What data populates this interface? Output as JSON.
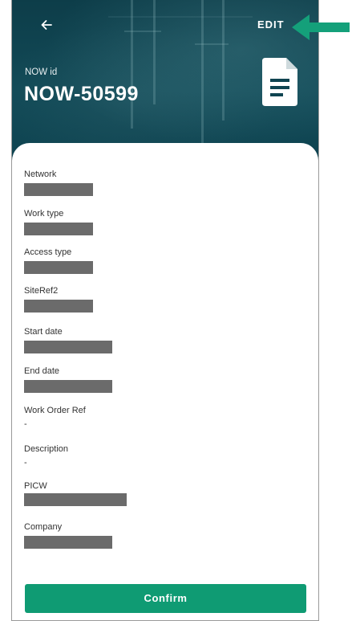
{
  "header": {
    "edit_label": "EDIT",
    "id_label": "NOW id",
    "id_value": "NOW-50599"
  },
  "fields": [
    {
      "label": "Network",
      "value": null
    },
    {
      "label": "Work type",
      "value": null
    },
    {
      "label": "Access type",
      "value": null
    },
    {
      "label": "SiteRef2",
      "value": null
    },
    {
      "label": "Start date",
      "value": null
    },
    {
      "label": "End date",
      "value": null
    },
    {
      "label": "Work Order Ref",
      "value": "-"
    },
    {
      "label": "Description",
      "value": "-"
    },
    {
      "label": "PICW",
      "value": null
    },
    {
      "label": "Company",
      "value": null
    }
  ],
  "actions": {
    "confirm_label": "Confirm"
  },
  "colors": {
    "header_bg": "#0f4451",
    "primary_button": "#0f9b73",
    "annotation_arrow": "#14a07a",
    "redaction": "#6b6b6b"
  },
  "icons": {
    "back": "arrow-left-icon",
    "document": "document-icon",
    "annotation": "annotation-arrow-icon"
  }
}
